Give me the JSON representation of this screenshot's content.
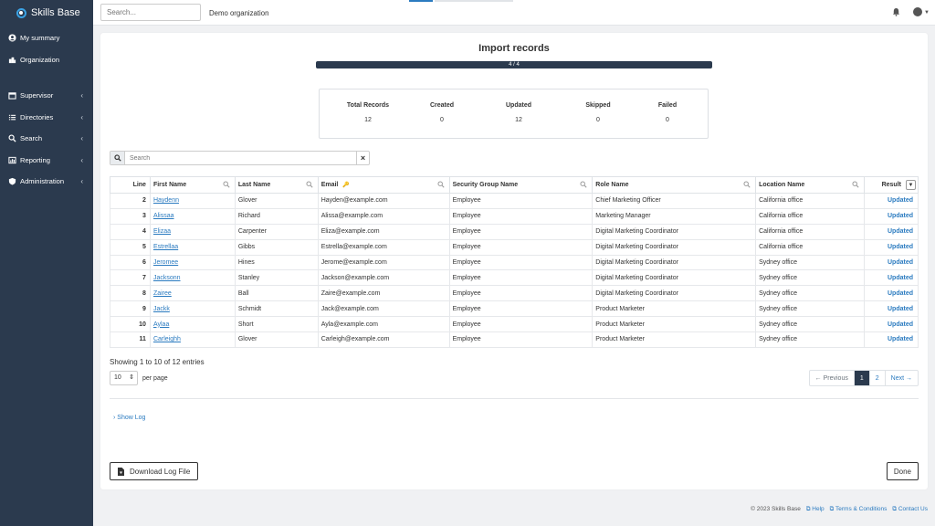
{
  "sidebar": {
    "brand": "Skills Base",
    "items": [
      {
        "label": "My summary",
        "icon": "user-circle-icon",
        "chevron": false
      },
      {
        "label": "Organization",
        "icon": "building-icon",
        "chevron": false
      },
      {
        "label": "Supervisor",
        "icon": "clipboard-icon",
        "chevron": true
      },
      {
        "label": "Directories",
        "icon": "list-icon",
        "chevron": true
      },
      {
        "label": "Search",
        "icon": "search-icon",
        "chevron": true
      },
      {
        "label": "Reporting",
        "icon": "chart-icon",
        "chevron": true
      },
      {
        "label": "Administration",
        "icon": "shield-icon",
        "chevron": true
      }
    ]
  },
  "topbar": {
    "search_placeholder": "Search...",
    "organization": "Demo organization"
  },
  "import": {
    "title": "Import records",
    "progress_label": "4 / 4",
    "progress": 1.0,
    "stats": [
      {
        "label": "Total Records",
        "value": "12"
      },
      {
        "label": "Created",
        "value": "0"
      },
      {
        "label": "Updated",
        "value": "12"
      },
      {
        "label": "Skipped",
        "value": "0"
      },
      {
        "label": "Failed",
        "value": "0"
      }
    ]
  },
  "table": {
    "search_placeholder": "Search",
    "columns": [
      "Line",
      "First Name",
      "Last Name",
      "Email",
      "Security Group Name",
      "Role Name",
      "Location Name",
      "Result"
    ],
    "rows": [
      [
        "2",
        "Haydenn",
        "Glover",
        "Hayden@example.com",
        "Employee",
        "Chief Marketing Officer",
        "California office",
        "Updated"
      ],
      [
        "3",
        "Alissaa",
        "Richard",
        "Alissa@example.com",
        "Employee",
        "Marketing Manager",
        "California office",
        "Updated"
      ],
      [
        "4",
        "Elizaa",
        "Carpenter",
        "Eliza@example.com",
        "Employee",
        "Digital Marketing Coordinator",
        "California office",
        "Updated"
      ],
      [
        "5",
        "Estrellaa",
        "Gibbs",
        "Estrella@example.com",
        "Employee",
        "Digital Marketing Coordinator",
        "California office",
        "Updated"
      ],
      [
        "6",
        "Jeromee",
        "Hines",
        "Jerome@example.com",
        "Employee",
        "Digital Marketing Coordinator",
        "Sydney office",
        "Updated"
      ],
      [
        "7",
        "Jacksonn",
        "Stanley",
        "Jackson@example.com",
        "Employee",
        "Digital Marketing Coordinator",
        "Sydney office",
        "Updated"
      ],
      [
        "8",
        "Zairee",
        "Ball",
        "Zaire@example.com",
        "Employee",
        "Digital Marketing Coordinator",
        "Sydney office",
        "Updated"
      ],
      [
        "9",
        "Jackk",
        "Schmidt",
        "Jack@example.com",
        "Employee",
        "Product Marketer",
        "Sydney office",
        "Updated"
      ],
      [
        "10",
        "Aylaa",
        "Short",
        "Ayla@example.com",
        "Employee",
        "Product Marketer",
        "Sydney office",
        "Updated"
      ],
      [
        "11",
        "Carleighh",
        "Glover",
        "Carleigh@example.com",
        "Employee",
        "Product Marketer",
        "Sydney office",
        "Updated"
      ]
    ],
    "showing": "Showing 1 to 10 of 12 entries",
    "per_page_value": "10",
    "per_page_label": "per page",
    "pagination": {
      "previous": "← Previous",
      "pages": [
        "1",
        "2"
      ],
      "next": "Next →",
      "active": "1"
    }
  },
  "show_log": "Show Log",
  "buttons": {
    "download": "Download Log File",
    "done": "Done"
  },
  "footer": {
    "copyright": "© 2023 Skills Base",
    "help": "Help",
    "terms": "Terms & Conditions",
    "contact": "Contact Us"
  },
  "colors": {
    "sidebar": "#2b3a4e",
    "link": "#2b7bc0",
    "accent": "#3aa2e4"
  }
}
